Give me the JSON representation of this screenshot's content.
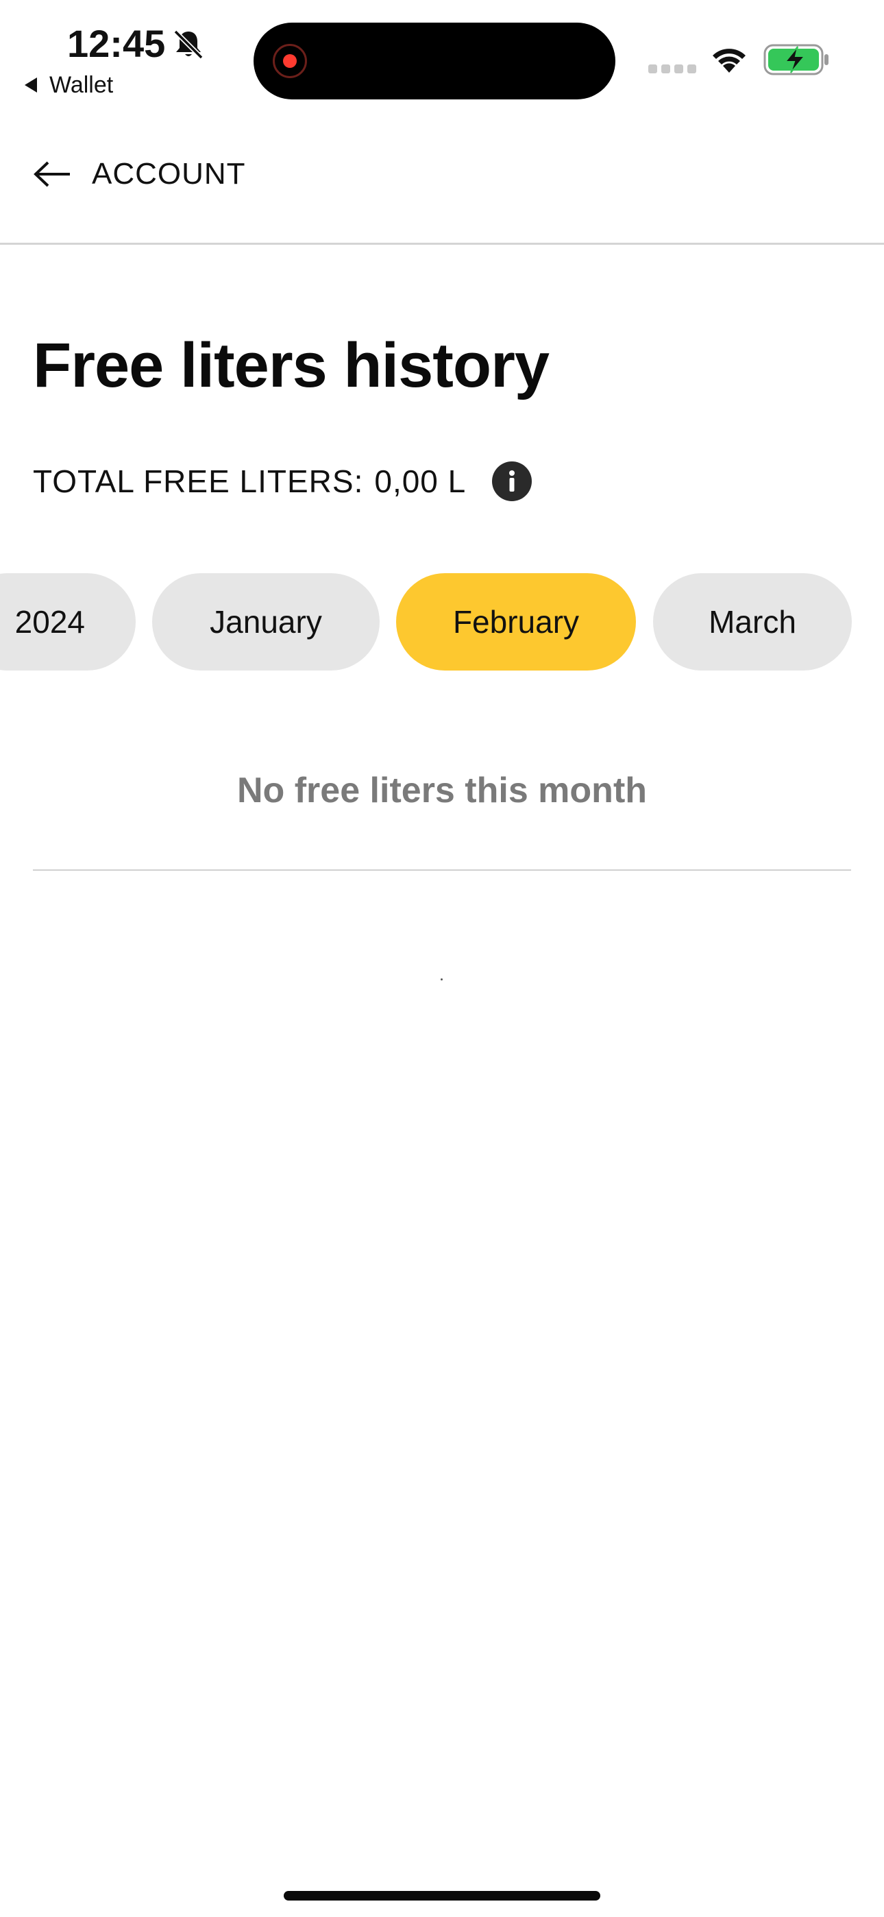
{
  "status_bar": {
    "time": "12:45",
    "back_app_label": "Wallet",
    "icons": [
      "bell-slash-icon",
      "recording-icon",
      "cellular-signal-icon",
      "wifi-icon",
      "battery-charging-icon"
    ],
    "battery_color": "#35c759",
    "recording_color": "#ff3b30"
  },
  "header": {
    "back_label": "ACCOUNT",
    "back_icon": "arrow-left-icon"
  },
  "main": {
    "title": "Free liters history",
    "total_label": "TOTAL FREE LITERS:",
    "total_value": "0,00 L",
    "info_icon": "info-icon",
    "period_tabs": [
      {
        "label": "2024",
        "selected": false
      },
      {
        "label": "January",
        "selected": false
      },
      {
        "label": "February",
        "selected": true
      },
      {
        "label": "March",
        "selected": false
      }
    ],
    "empty_message": "No free liters this month"
  },
  "colors": {
    "accent": "#fdc82f",
    "pill_background": "#e6e6e6",
    "muted_text": "#7a7a7a"
  }
}
